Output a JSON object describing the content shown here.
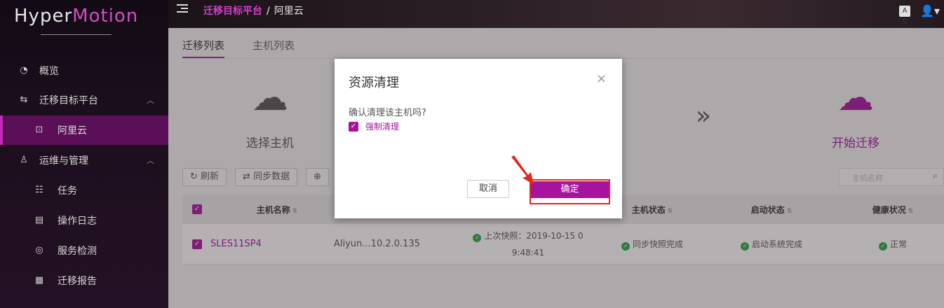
{
  "app": {
    "logo_part1": "Hyper",
    "logo_part2": "Motion"
  },
  "sidebar": {
    "items": [
      {
        "label": "概览",
        "icon": "dashboard-icon"
      },
      {
        "label": "迁移目标平台",
        "icon": "exchange-icon"
      },
      {
        "label": "阿里云",
        "icon": "cloud-icon"
      },
      {
        "label": "运维与管理",
        "icon": "user-ops-icon"
      },
      {
        "label": "任务",
        "icon": "task-icon"
      },
      {
        "label": "操作日志",
        "icon": "log-icon"
      },
      {
        "label": "服务检测",
        "icon": "service-check-icon"
      },
      {
        "label": "迁移报告",
        "icon": "report-icon"
      }
    ]
  },
  "header": {
    "breadcrumb_link": "迁移目标平台",
    "breadcrumb_sep": "/",
    "breadcrumb_current": "阿里云",
    "lang_icon_text": "A文"
  },
  "tabs": [
    {
      "label": "迁移列表"
    },
    {
      "label": "主机列表"
    }
  ],
  "steps": {
    "select_host": "选择主机",
    "start_migration": "开始迁移"
  },
  "toolbar": {
    "refresh": "刷新",
    "sync": "同步数据",
    "search_placeholder": "主机名称"
  },
  "table": {
    "headers": [
      "主机名称",
      "主机状态",
      "启动状态",
      "健康状况"
    ],
    "row": {
      "host_name": "SLES11SP4",
      "platform": "Aliyun...10.2.0.135",
      "snapshot": "上次快照：2019-10-15 0",
      "snapshot_time": "9:48:41",
      "host_status": "同步快照完成",
      "boot_status": "启动系统完成",
      "health": "正常"
    }
  },
  "modal": {
    "title": "资源清理",
    "close": "×",
    "message": "确认清理该主机吗?",
    "force_label": "强制清理",
    "cancel": "取消",
    "confirm": "确定"
  },
  "colors": {
    "accent": "#a6149e",
    "highlight": "#e8231d",
    "ok": "#2aa84a"
  }
}
